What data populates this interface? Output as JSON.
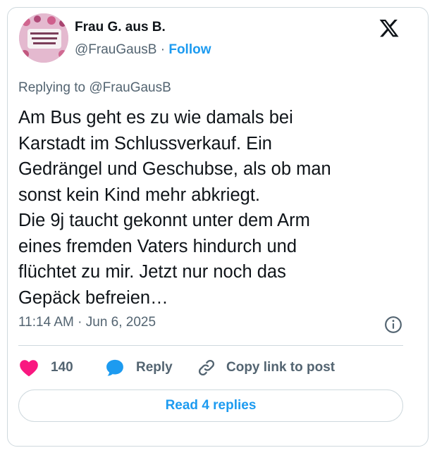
{
  "author": {
    "display_name": "Frau G. aus B.",
    "handle": "@FrauGausB",
    "separator": "·",
    "follow_label": "Follow"
  },
  "replying": {
    "prefix": "Replying to",
    "handle": "@FrauGausB"
  },
  "tweet_lines": [
    "Am Bus geht es zu wie damals bei",
    "Karstadt im Schlussverkauf. Ein",
    "Gedrängel und Geschubse, als ob man",
    "sonst kein Kind mehr abkriegt.",
    "Die 9j taucht gekonnt unter dem Arm",
    "eines fremden Vaters hindurch und",
    "flüchtet zu mir. Jetzt nur noch das",
    "Gepäck befreien…"
  ],
  "timestamp": "11:14 AM · Jun 6, 2025",
  "actions": {
    "like_count": "140",
    "reply_label": "Reply",
    "copy_label": "Copy link to post"
  },
  "read_replies_label": "Read 4 replies",
  "colors": {
    "accent": "#1d9bf0",
    "like": "#f91880",
    "secondary_text": "#536471",
    "border": "#cfd9de"
  },
  "icons": {
    "logo": "x-logo-icon",
    "info": "info-icon",
    "like": "heart-icon",
    "reply": "speech-bubble-icon",
    "copy": "link-icon"
  }
}
